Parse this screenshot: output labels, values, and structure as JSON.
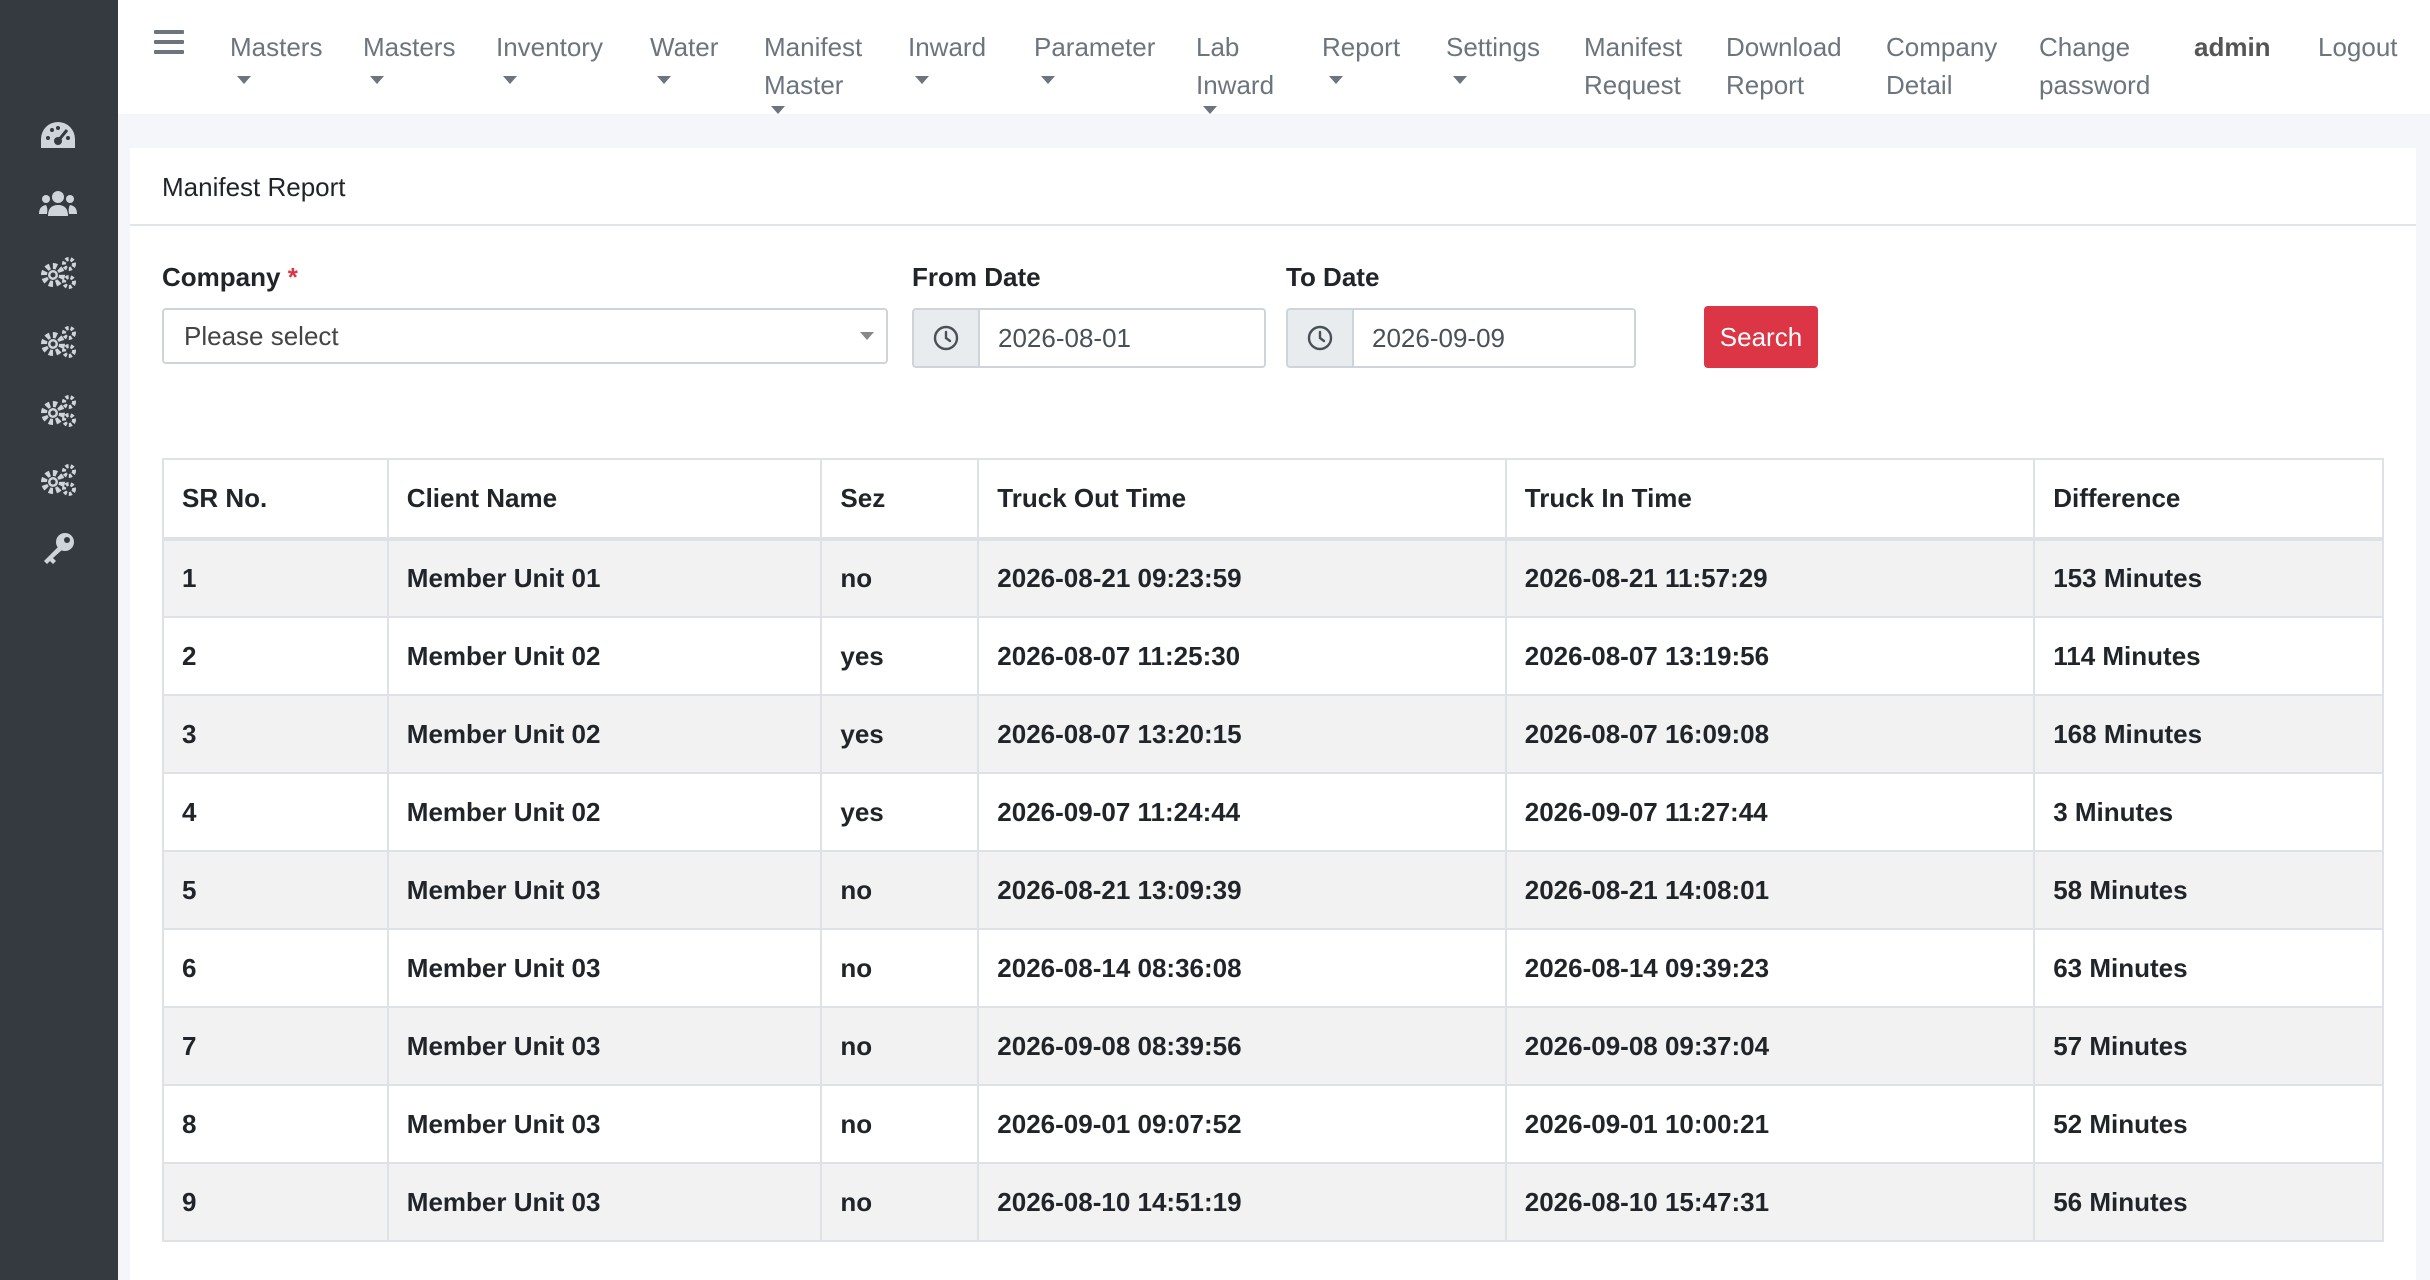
{
  "nav": {
    "items": [
      {
        "label": "Masters",
        "caret": true
      },
      {
        "label": "Masters",
        "caret": true
      },
      {
        "label": "Inventory",
        "caret": true
      },
      {
        "label": "Water",
        "caret": true
      },
      {
        "label": "Manifest Master",
        "caret": true
      },
      {
        "label": "Inward",
        "caret": true
      },
      {
        "label": "Parameter",
        "caret": true
      },
      {
        "label": "Lab Inward",
        "caret": true
      },
      {
        "label": "Report",
        "caret": true
      },
      {
        "label": "Settings",
        "caret": true
      },
      {
        "label": "Manifest Request",
        "caret": false
      },
      {
        "label": "Download Report",
        "caret": false
      },
      {
        "label": "Company Detail",
        "caret": false
      },
      {
        "label": "Change password",
        "caret": false
      },
      {
        "label": "admin",
        "caret": false
      },
      {
        "label": "Logout",
        "caret": false
      }
    ]
  },
  "sidebar": {
    "icons": [
      "dashboard-icon",
      "users-icon",
      "cogs-icon",
      "cogs-icon",
      "cogs-icon",
      "cogs-icon",
      "key-icon"
    ]
  },
  "card": {
    "title": "Manifest Report"
  },
  "form": {
    "company_label": "Company",
    "company_required": "*",
    "company_value": "Please select",
    "from_label": "From Date",
    "from_value": "2026-08-01",
    "to_label": "To Date",
    "to_value": "2026-09-09",
    "search_label": "Search"
  },
  "table": {
    "headers": [
      "SR No.",
      "Client Name",
      "Sez",
      "Truck Out Time",
      "Truck In Time",
      "Difference"
    ],
    "rows": [
      [
        "1",
        "Member Unit 01",
        "no",
        "2026-08-21 09:23:59",
        "2026-08-21 11:57:29",
        "153 Minutes"
      ],
      [
        "2",
        "Member Unit 02",
        "yes",
        "2026-08-07 11:25:30",
        "2026-08-07 13:19:56",
        "114 Minutes"
      ],
      [
        "3",
        "Member Unit 02",
        "yes",
        "2026-08-07 13:20:15",
        "2026-08-07 16:09:08",
        "168 Minutes"
      ],
      [
        "4",
        "Member Unit 02",
        "yes",
        "2026-09-07 11:24:44",
        "2026-09-07 11:27:44",
        "3 Minutes"
      ],
      [
        "5",
        "Member Unit 03",
        "no",
        "2026-08-21 13:09:39",
        "2026-08-21 14:08:01",
        "58 Minutes"
      ],
      [
        "6",
        "Member Unit 03",
        "no",
        "2026-08-14 08:36:08",
        "2026-08-14 09:39:23",
        "63 Minutes"
      ],
      [
        "7",
        "Member Unit 03",
        "no",
        "2026-09-08 08:39:56",
        "2026-09-08 09:37:04",
        "57 Minutes"
      ],
      [
        "8",
        "Member Unit 03",
        "no",
        "2026-09-01 09:07:52",
        "2026-09-01 10:00:21",
        "52 Minutes"
      ],
      [
        "9",
        "Member Unit 03",
        "no",
        "2026-08-10 14:51:19",
        "2026-08-10 15:47:31",
        "56 Minutes"
      ]
    ]
  },
  "colors": {
    "sidebar": "#343a40",
    "accent": "#dc3545",
    "stripe": "#f2f2f2"
  }
}
